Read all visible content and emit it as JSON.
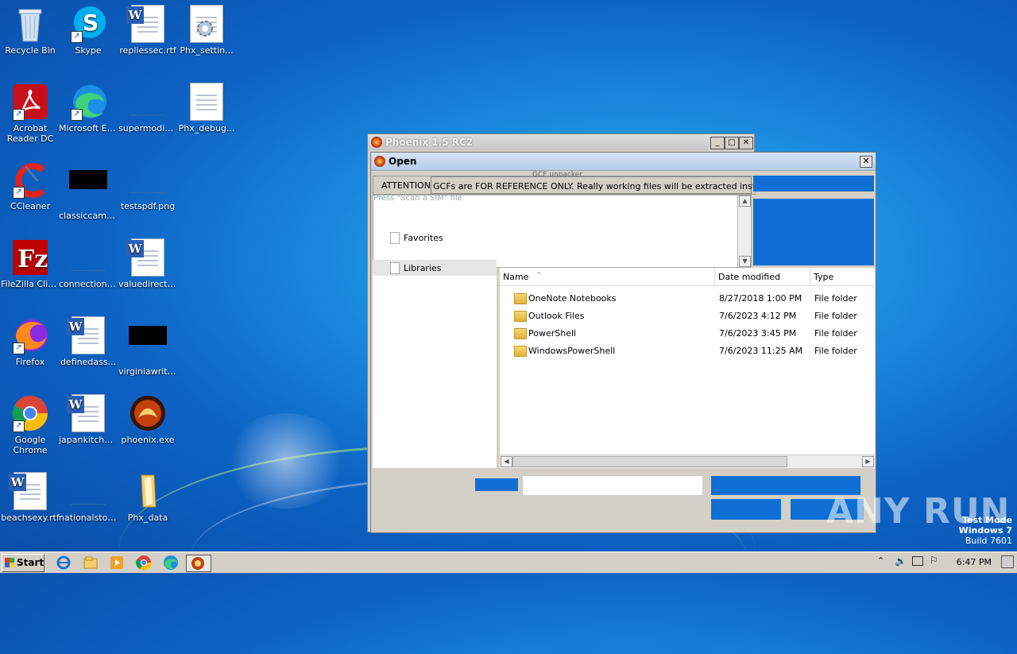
{
  "desktop": {
    "icons": [
      {
        "label": "Recycle Bin"
      },
      {
        "label": "Skype"
      },
      {
        "label": "repliessec.rtf"
      },
      {
        "label": "Phx_settin..."
      },
      {
        "label": "Acrobat Reader DC"
      },
      {
        "label": "Microsoft Edge"
      },
      {
        "label": "supermodifi..."
      },
      {
        "label": "Phx_debug..."
      },
      {
        "label": "CCleaner"
      },
      {
        "label": "classiccame..."
      },
      {
        "label": "testspdf.png"
      },
      {
        "label": "FileZilla Client"
      },
      {
        "label": "connectionc..."
      },
      {
        "label": "valuedirecto..."
      },
      {
        "label": "Firefox"
      },
      {
        "label": "definedass..."
      },
      {
        "label": "virginiawrite..."
      },
      {
        "label": "Google Chrome"
      },
      {
        "label": "japankitche..."
      },
      {
        "label": "phoenix.exe"
      },
      {
        "label": "beachsexy.rtf"
      },
      {
        "label": "nationalstor..."
      },
      {
        "label": "Phx_data"
      }
    ]
  },
  "phoenix_window": {
    "title": "Phoenix 1.5 RC2",
    "controls": {
      "minimize": "_",
      "maximize": "□",
      "close": "✕"
    }
  },
  "open_dialog": {
    "title": "Open",
    "close": "✕",
    "attention_label": "ATTENTION:",
    "attention_msg": "GCFs are FOR REFERENCE ONLY. Really working files will be extracted instead!!",
    "ghost_top": "GCF unpacker",
    "ghost_log": "Press \"Scan a SIM\" file",
    "nav": [
      {
        "label": "Favorites"
      },
      {
        "label": "Libraries"
      }
    ],
    "columns": {
      "name": "Name",
      "date": "Date modified",
      "type": "Type",
      "sort_indicator": "^"
    },
    "files": [
      {
        "name": "OneNote Notebooks",
        "date": "8/27/2018 1:00 PM",
        "type": "File folder"
      },
      {
        "name": "Outlook Files",
        "date": "7/6/2023 4:12 PM",
        "type": "File folder"
      },
      {
        "name": "PowerShell",
        "date": "7/6/2023 3:45 PM",
        "type": "File folder"
      },
      {
        "name": "WindowsPowerShell",
        "date": "7/6/2023 11:25 AM",
        "type": "File folder"
      }
    ]
  },
  "taskbar": {
    "start": "Start",
    "clock": "6:47 PM"
  },
  "watermark": {
    "line1": "Test Mode",
    "line2": "Windows 7",
    "line3": "Build 7601",
    "brand": "ANY RUN"
  },
  "colors": {
    "desktop_blue": "#0d62c4",
    "dialog_blue_panel": "#0f6fd4",
    "window_gray": "#d4d0c8"
  }
}
